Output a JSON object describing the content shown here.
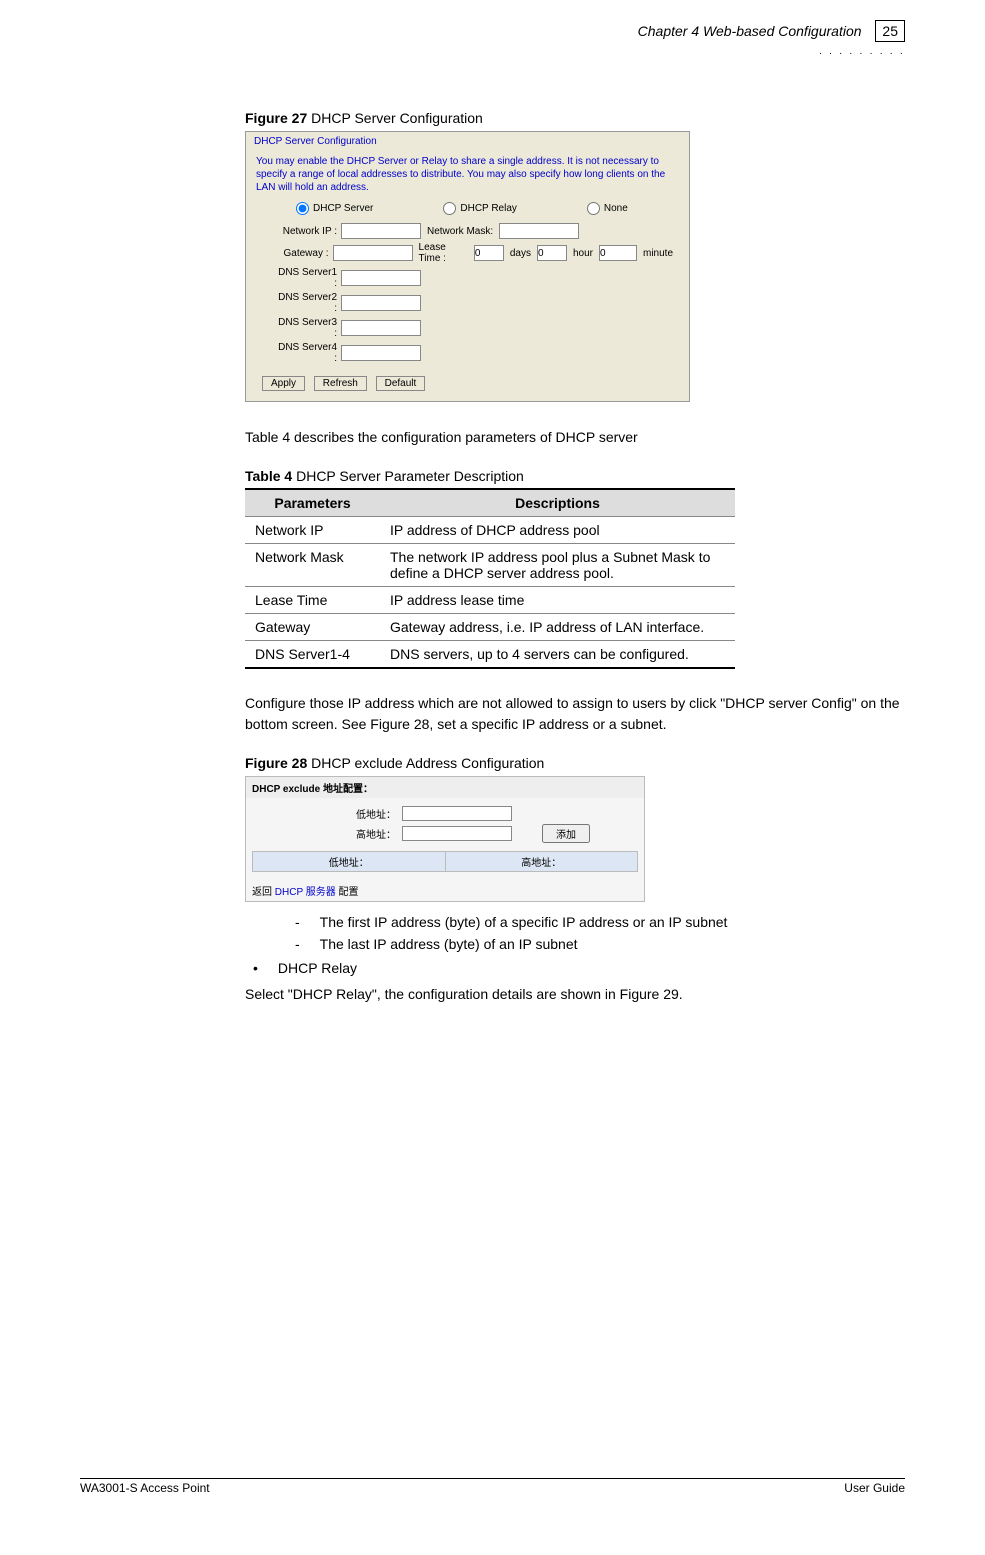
{
  "header": {
    "chapter": "Chapter 4 Web-based Configuration",
    "page": "25"
  },
  "figure27": {
    "caption_bold": "Figure 27",
    "caption_rest": " DHCP Server Configuration",
    "box_title": "DHCP Server Configuration",
    "desc": "You may enable the DHCP Server or Relay to share a single address. It is not necessary to specify a range of local addresses to distribute. You may also specify how long clients on the LAN will hold an address.",
    "radio1": "DHCP Server",
    "radio2": "DHCP Relay",
    "radio3": "None",
    "network_ip_lbl": "Network IP :",
    "network_mask_lbl": "Network Mask:",
    "gateway_lbl": "Gateway :",
    "lease_lbl": "Lease Time :",
    "lease_days": "0",
    "lease_days_unit": "days",
    "lease_hours": "0",
    "lease_hours_unit": "hour",
    "lease_min": "0",
    "lease_min_unit": "minute",
    "dns1": "DNS Server1 :",
    "dns2": "DNS Server2 :",
    "dns3": "DNS Server3 :",
    "dns4": "DNS Server4 :",
    "btn_apply": "Apply",
    "btn_refresh": "Refresh",
    "btn_default": "Default"
  },
  "para1": "Table 4 describes the configuration parameters of DHCP server",
  "table4": {
    "caption_bold": "Table 4",
    "caption_rest": " DHCP Server Parameter Description",
    "h1": "Parameters",
    "h2": "Descriptions",
    "rows": [
      {
        "p": "Network IP",
        "d": "IP address of DHCP address pool"
      },
      {
        "p": "Network Mask",
        "d": "The network IP address pool plus a Subnet Mask to define a DHCP server address pool."
      },
      {
        "p": "Lease Time",
        "d": "IP address lease time"
      },
      {
        "p": "Gateway",
        "d": "Gateway address, i.e. IP address of LAN interface."
      },
      {
        "p": "DNS Server1-4",
        "d": "DNS servers, up to 4 servers can be configured."
      }
    ]
  },
  "para2": "Configure those IP address which are not allowed to assign to users by click \"DHCP server Config\" on the bottom screen. See Figure 28, set a specific IP address or a subnet.",
  "figure28": {
    "caption_bold": "Figure 28",
    "caption_rest": " DHCP exclude Address Configuration",
    "title": "DHCP exclude 地址配置：",
    "low_lbl": "低地址：",
    "high_lbl": "高地址：",
    "add_btn": "添加",
    "th_low": "低地址：",
    "th_high": "高地址：",
    "return_prefix": "返回 ",
    "return_link": "DHCP 服务器",
    "return_suffix": " 配置"
  },
  "dash1": "The first IP address (byte) of a specific IP address or an IP subnet",
  "dash2": "The last IP address (byte) of an IP subnet",
  "bullet1": "DHCP Relay",
  "para3": "Select \"DHCP Relay\", the configuration details are shown in Figure 29.",
  "footer": {
    "left": "WA3001-S Access Point",
    "right": "User Guide"
  }
}
